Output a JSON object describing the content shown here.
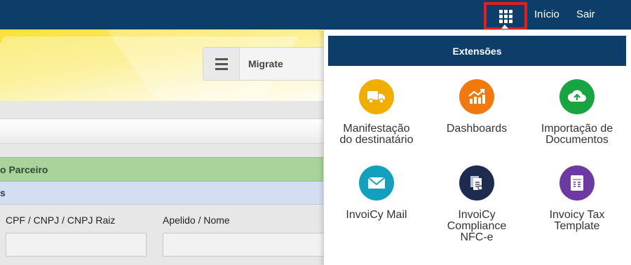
{
  "nav": {
    "apps_icon": "grid-icon",
    "links": [
      "Início",
      "Sair"
    ]
  },
  "toolbar": {
    "menu_icon": "hamburger-icon",
    "label": "Migrate"
  },
  "form": {
    "section_green": "o Parceiro",
    "section_blue": "s",
    "fields": [
      {
        "label": "CPF / CNPJ / CNPJ Raiz",
        "value": ""
      },
      {
        "label": "Apelido / Nome",
        "value": ""
      }
    ]
  },
  "extensions": {
    "title": "Extensões",
    "items": [
      {
        "lines": [
          "Manifestação",
          "do destinatário"
        ],
        "icon": "truck-icon",
        "color": "#f0ae00"
      },
      {
        "lines": [
          "Dashboards"
        ],
        "icon": "chart-icon",
        "color": "#f07a10"
      },
      {
        "lines": [
          "Importação de",
          "Documentos"
        ],
        "icon": "cloud-upload-icon",
        "color": "#18a541"
      },
      {
        "lines": [
          "InvoiCy Mail"
        ],
        "icon": "mail-icon",
        "color": "#12a0be"
      },
      {
        "lines": [
          "InvoiCy",
          "Compliance",
          "NFC-e"
        ],
        "icon": "compliance-icon",
        "color": "#1c2b4e"
      },
      {
        "lines": [
          "Invoicy Tax",
          "Template"
        ],
        "icon": "tax-icon",
        "color": "#6d3aa1"
      }
    ]
  }
}
